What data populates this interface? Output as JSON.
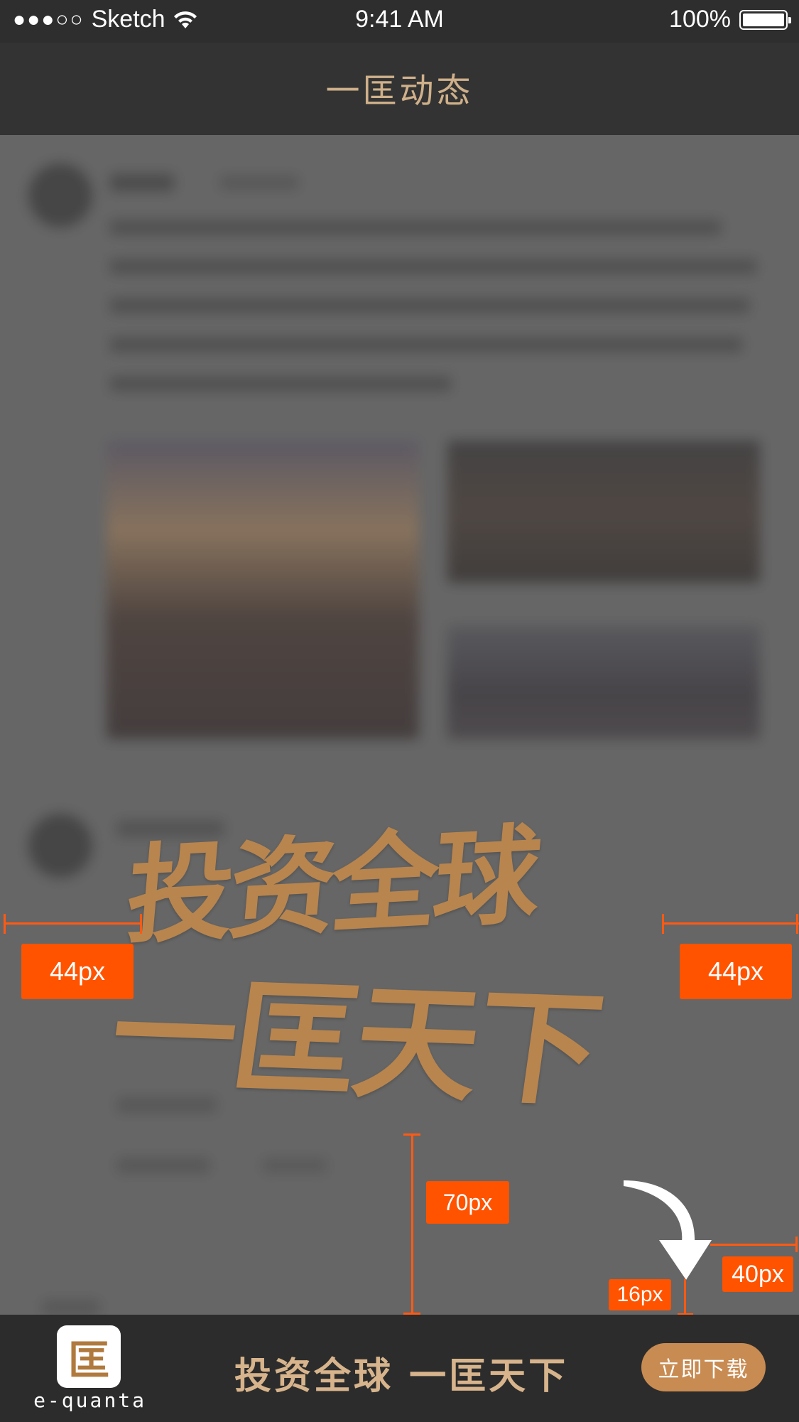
{
  "status_bar": {
    "signal": "●●●○○",
    "carrier": "Sketch",
    "time": "9:41 AM",
    "battery": "100%"
  },
  "nav": {
    "title": "一匡动态"
  },
  "overlay": {
    "slogan_line1": "投资全球",
    "slogan_line2": "一匡天下"
  },
  "annotations": {
    "left_margin": "44px",
    "right_margin": "44px",
    "bottom_gap": "70px",
    "arrow_gap": "16px",
    "arrow_right": "40px",
    "color": "#ff5300"
  },
  "bottom_bar": {
    "logo_glyph": "匡",
    "logo_text": "e-quanta",
    "slogan": "投资全球 一匡天下",
    "download_label": "立即下载",
    "button_color": "#c88b52"
  }
}
